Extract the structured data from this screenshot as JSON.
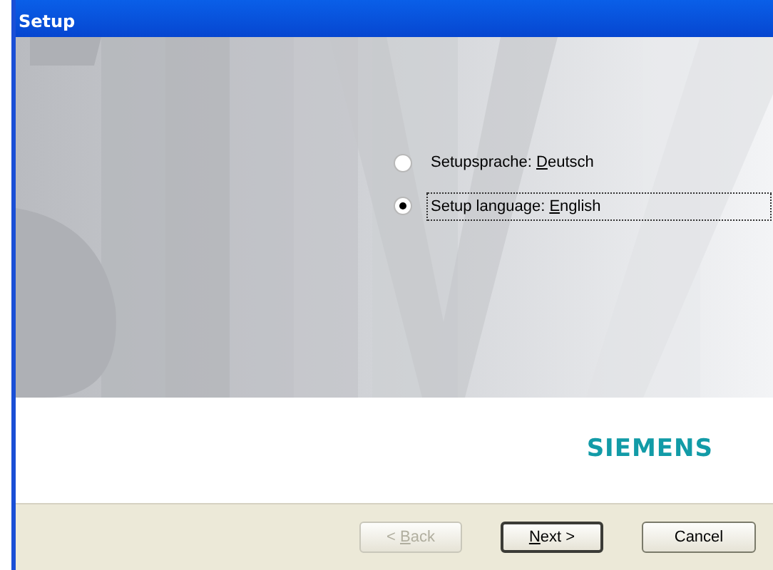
{
  "window": {
    "title": "Setup"
  },
  "languages": [
    {
      "label_parts": {
        "before": "Setupsprache: ",
        "key": "D",
        "after": "eutsch"
      },
      "selected": false,
      "focused": false
    },
    {
      "label_parts": {
        "before": "Setup language: ",
        "key": "E",
        "after": "nglish"
      },
      "selected": true,
      "focused": true
    }
  ],
  "logo": "SIEMENS",
  "buttons": [
    {
      "label_parts": {
        "before": "< ",
        "key": "B",
        "after": "ack"
      },
      "disabled": true,
      "default": false
    },
    {
      "label_parts": {
        "key": "N",
        "after": "ext >"
      },
      "disabled": false,
      "default": true
    },
    {
      "label_parts": {
        "before": "Cancel"
      },
      "disabled": false,
      "default": false
    }
  ]
}
